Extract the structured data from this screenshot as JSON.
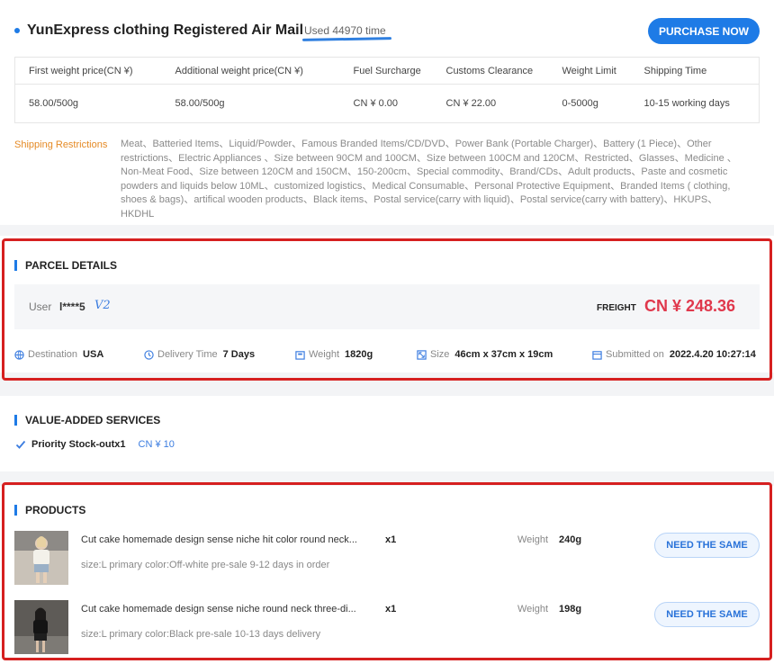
{
  "header": {
    "title": "YunExpress clothing Registered Air Mail",
    "used": "Used 44970 time",
    "purchase_label": "PURCHASE NOW"
  },
  "rates": {
    "columns": [
      "First weight price(CN ¥)",
      "Additional weight price(CN ¥)",
      "Fuel Surcharge",
      "Customs Clearance",
      "Weight Limit",
      "Shipping Time"
    ],
    "values": [
      "58.00/500g",
      "58.00/500g",
      "CN ¥ 0.00",
      "CN ¥ 22.00",
      "0-5000g",
      "10-15 working days"
    ]
  },
  "restrictions": {
    "label": "Shipping Restrictions",
    "text": "Meat、Batteried Items、Liquid/Powder、Famous Branded Items/CD/DVD、Power Bank (Portable Charger)、Battery (1 Piece)、Other restrictions、Electric Appliances 、Size between 90CM and 100CM、Size between 100CM and 120CM、Restricted、Glasses、Medicine 、Non-Meat Food、Size between 120CM and 150CM、150-200cm、Special commodity、Brand/CDs、Adult products、Paste and cosmetic powders and liquids below 10ML、customized logistics、Medical Consumable、Personal Protective Equipment、Branded Items ( clothing, shoes & bags)、artifical wooden products、Black items、Postal service(carry with liquid)、Postal service(carry with battery)、HKUPS、HKDHL"
  },
  "parcel": {
    "heading": "PARCEL DETAILS",
    "user_label": "User",
    "user_name": "l****5",
    "vip": "V2",
    "freight_label": "FREIGHT",
    "freight_value": "CN ¥ 248.36",
    "destination_label": "Destination",
    "destination": "USA",
    "delivery_label": "Delivery Time",
    "delivery": "7 Days",
    "weight_label": "Weight",
    "weight": "1820g",
    "size_label": "Size",
    "size": "46cm x 37cm x 19cm",
    "submitted_label": "Submitted on",
    "submitted": "2022.4.20 10:27:14"
  },
  "value_added": {
    "heading": "VALUE-ADDED SERVICES",
    "items": [
      {
        "name": "Priority Stock-outx1",
        "price": "CN ¥ 10"
      }
    ]
  },
  "products": {
    "heading": "PRODUCTS",
    "weight_label": "Weight",
    "button_label": "NEED THE SAME",
    "items": [
      {
        "name": "Cut cake homemade design sense niche hit color round neck...",
        "sku": "size:L primary color:Off-white pre-sale 9-12 days in order",
        "qty": "x1",
        "weight": "240g"
      },
      {
        "name": "Cut cake homemade design sense niche round neck three-di...",
        "sku": "size:L primary color:Black pre-sale 10-13 days delivery",
        "qty": "x1",
        "weight": "198g"
      }
    ]
  },
  "colors": {
    "accent": "#1e7be6",
    "freight": "#e0384c",
    "restriction_label": "#e58a25",
    "annotation": "#d62020"
  }
}
